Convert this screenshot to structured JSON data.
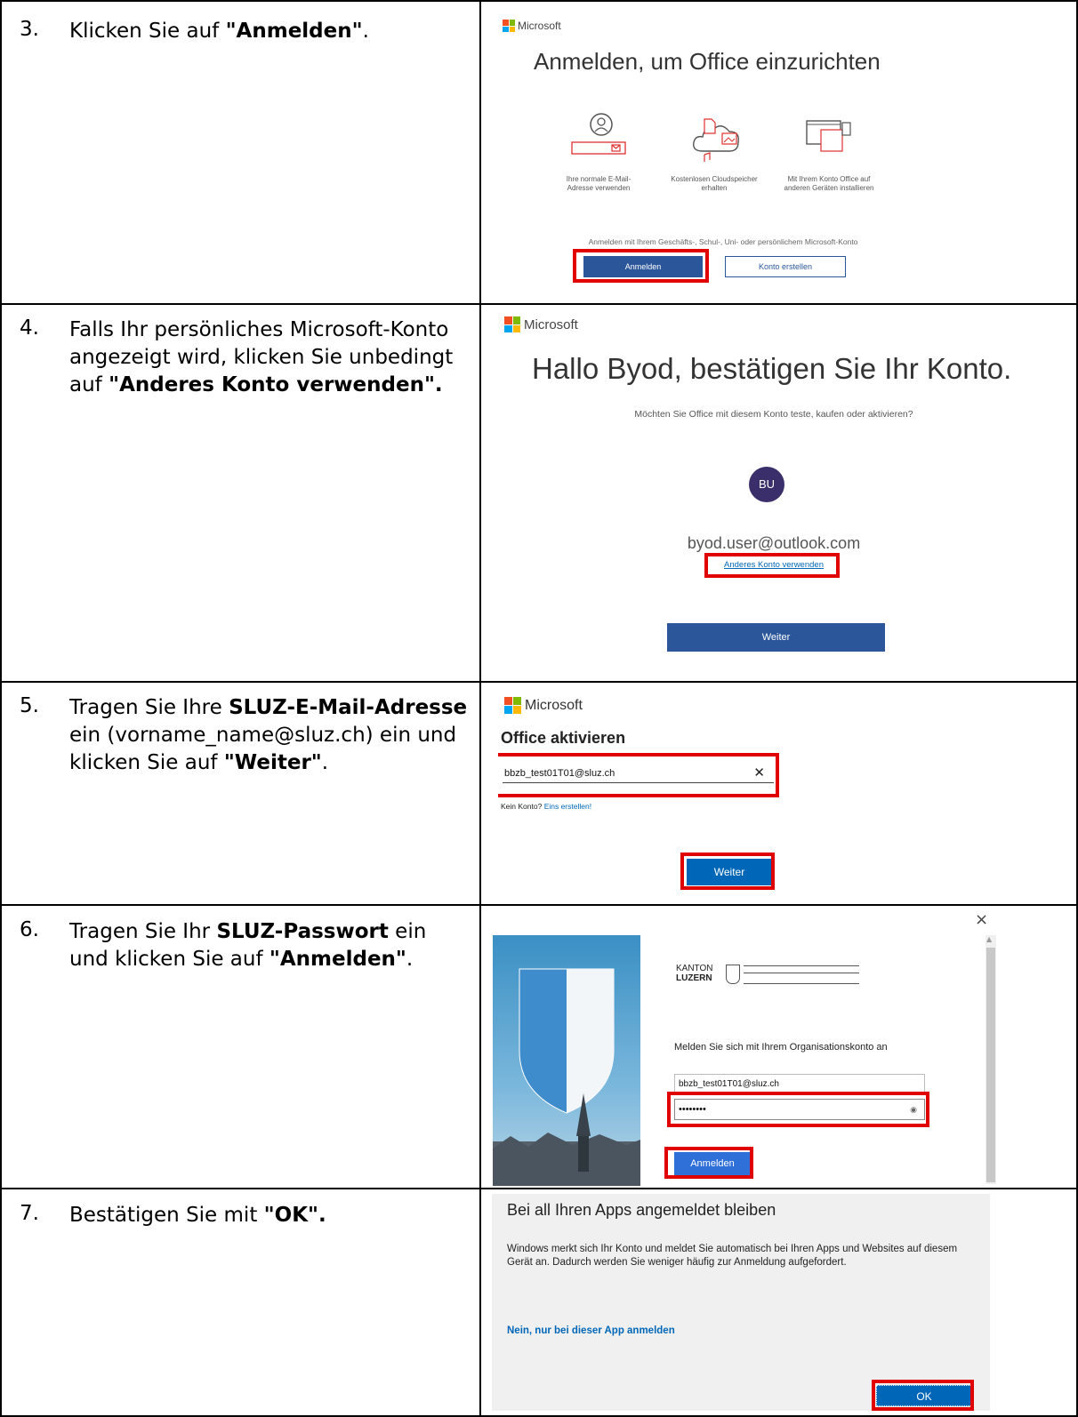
{
  "steps": [
    {
      "number": "3.",
      "pre": "Klicken Sie auf ",
      "bold": "\"Anmelden\"",
      "post": "."
    },
    {
      "number": "4.",
      "pre": "Falls Ihr persönliches Microsoft-Konto angezeigt wird, klicken Sie unbedingt auf ",
      "bold": "\"Anderes Konto verwenden\".",
      "post": ""
    },
    {
      "number": "5.",
      "pre": "Tragen Sie Ihre ",
      "bold": "SLUZ-E-Mail-Adresse",
      "mid": " ein (vorname_name@sluz.ch) ein und klicken Sie auf ",
      "bold2": "\"Weiter\"",
      "post": "."
    },
    {
      "number": "6.",
      "pre": "Tragen Sie Ihr ",
      "bold": "SLUZ-Passwort",
      "mid": " ein und klicken Sie auf ",
      "bold2": "\"Anmelden\"",
      "post": "."
    },
    {
      "number": "7.",
      "pre": "Bestätigen Sie mit ",
      "bold": "\"OK\".",
      "post": ""
    }
  ],
  "shot3": {
    "brand": "Microsoft",
    "title": "Anmelden, um Office einzurichten",
    "features": [
      {
        "label": "Ihre normale E-Mail-Adresse verwenden",
        "icon": "user-mail-icon"
      },
      {
        "label": "Kostenlosen Cloudspeicher erhalten",
        "icon": "cloud-files-icon"
      },
      {
        "label": "Mit Ihrem Konto Office auf anderen Geräten installieren",
        "icon": "devices-icon"
      }
    ],
    "note": "Anmelden mit Ihrem Geschäfts-, Schul-, Uni- oder persönlichem Microsoft-Konto",
    "signin": "Anmelden",
    "create": "Konto erstellen"
  },
  "shot4": {
    "brand": "Microsoft",
    "title": "Hallo Byod, bestätigen Sie Ihr Konto.",
    "subtitle": "Möchten Sie Office mit diesem Konto teste, kaufen oder aktivieren?",
    "initials": "BU",
    "email": "byod.user@outlook.com",
    "other": "Anderes Konto verwenden",
    "next": "Weiter"
  },
  "shot5": {
    "brand": "Microsoft",
    "title": "Office aktivieren",
    "email_value": "bbzb_test01T01@sluz.ch",
    "no_account": "Kein Konto? ",
    "create_link": "Eins erstellen!",
    "next": "Weiter"
  },
  "shot6": {
    "close": "×",
    "org_line1": "KANTON",
    "org_line2": "LUZERN",
    "prompt": "Melden Sie sich mit Ihrem Organisationskonto an",
    "username": "bbzb_test01T01@sluz.ch",
    "password": "••••••••",
    "signin": "Anmelden"
  },
  "shot7": {
    "title": "Bei all Ihren Apps angemeldet bleiben",
    "body": "Windows merkt sich Ihr Konto und meldet Sie automatisch bei Ihren Apps und Websites auf diesem Gerät an. Dadurch werden Sie weniger häufig zur Anmeldung aufgefordert.",
    "link": "Nein, nur bei dieser App anmelden",
    "ok": "OK"
  },
  "colors": {
    "ms_red": "#f25022",
    "ms_green": "#7fba00",
    "ms_blue": "#00a4ef",
    "ms_yellow": "#ffb900",
    "primary": "#2b579a",
    "highlight": "#e00000",
    "avatar": "#3a2f6b",
    "link": "#0067b8"
  }
}
